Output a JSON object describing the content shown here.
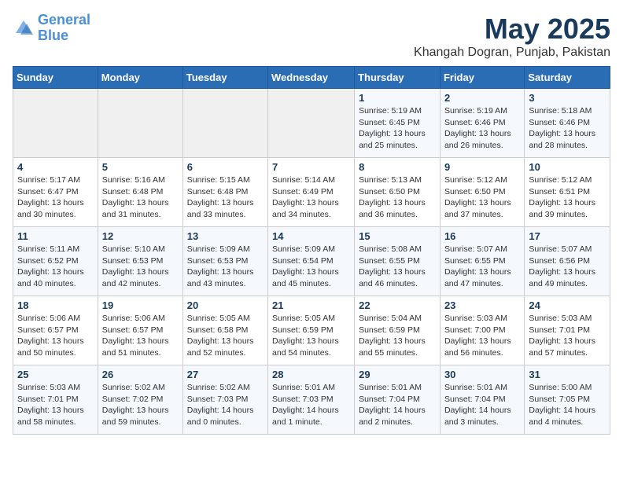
{
  "logo": {
    "line1": "General",
    "line2": "Blue"
  },
  "title": "May 2025",
  "subtitle": "Khangah Dogran, Punjab, Pakistan",
  "weekdays": [
    "Sunday",
    "Monday",
    "Tuesday",
    "Wednesday",
    "Thursday",
    "Friday",
    "Saturday"
  ],
  "weeks": [
    [
      {
        "day": "",
        "info": ""
      },
      {
        "day": "",
        "info": ""
      },
      {
        "day": "",
        "info": ""
      },
      {
        "day": "",
        "info": ""
      },
      {
        "day": "1",
        "info": "Sunrise: 5:19 AM\nSunset: 6:45 PM\nDaylight: 13 hours\nand 25 minutes."
      },
      {
        "day": "2",
        "info": "Sunrise: 5:19 AM\nSunset: 6:46 PM\nDaylight: 13 hours\nand 26 minutes."
      },
      {
        "day": "3",
        "info": "Sunrise: 5:18 AM\nSunset: 6:46 PM\nDaylight: 13 hours\nand 28 minutes."
      }
    ],
    [
      {
        "day": "4",
        "info": "Sunrise: 5:17 AM\nSunset: 6:47 PM\nDaylight: 13 hours\nand 30 minutes."
      },
      {
        "day": "5",
        "info": "Sunrise: 5:16 AM\nSunset: 6:48 PM\nDaylight: 13 hours\nand 31 minutes."
      },
      {
        "day": "6",
        "info": "Sunrise: 5:15 AM\nSunset: 6:48 PM\nDaylight: 13 hours\nand 33 minutes."
      },
      {
        "day": "7",
        "info": "Sunrise: 5:14 AM\nSunset: 6:49 PM\nDaylight: 13 hours\nand 34 minutes."
      },
      {
        "day": "8",
        "info": "Sunrise: 5:13 AM\nSunset: 6:50 PM\nDaylight: 13 hours\nand 36 minutes."
      },
      {
        "day": "9",
        "info": "Sunrise: 5:12 AM\nSunset: 6:50 PM\nDaylight: 13 hours\nand 37 minutes."
      },
      {
        "day": "10",
        "info": "Sunrise: 5:12 AM\nSunset: 6:51 PM\nDaylight: 13 hours\nand 39 minutes."
      }
    ],
    [
      {
        "day": "11",
        "info": "Sunrise: 5:11 AM\nSunset: 6:52 PM\nDaylight: 13 hours\nand 40 minutes."
      },
      {
        "day": "12",
        "info": "Sunrise: 5:10 AM\nSunset: 6:53 PM\nDaylight: 13 hours\nand 42 minutes."
      },
      {
        "day": "13",
        "info": "Sunrise: 5:09 AM\nSunset: 6:53 PM\nDaylight: 13 hours\nand 43 minutes."
      },
      {
        "day": "14",
        "info": "Sunrise: 5:09 AM\nSunset: 6:54 PM\nDaylight: 13 hours\nand 45 minutes."
      },
      {
        "day": "15",
        "info": "Sunrise: 5:08 AM\nSunset: 6:55 PM\nDaylight: 13 hours\nand 46 minutes."
      },
      {
        "day": "16",
        "info": "Sunrise: 5:07 AM\nSunset: 6:55 PM\nDaylight: 13 hours\nand 47 minutes."
      },
      {
        "day": "17",
        "info": "Sunrise: 5:07 AM\nSunset: 6:56 PM\nDaylight: 13 hours\nand 49 minutes."
      }
    ],
    [
      {
        "day": "18",
        "info": "Sunrise: 5:06 AM\nSunset: 6:57 PM\nDaylight: 13 hours\nand 50 minutes."
      },
      {
        "day": "19",
        "info": "Sunrise: 5:06 AM\nSunset: 6:57 PM\nDaylight: 13 hours\nand 51 minutes."
      },
      {
        "day": "20",
        "info": "Sunrise: 5:05 AM\nSunset: 6:58 PM\nDaylight: 13 hours\nand 52 minutes."
      },
      {
        "day": "21",
        "info": "Sunrise: 5:05 AM\nSunset: 6:59 PM\nDaylight: 13 hours\nand 54 minutes."
      },
      {
        "day": "22",
        "info": "Sunrise: 5:04 AM\nSunset: 6:59 PM\nDaylight: 13 hours\nand 55 minutes."
      },
      {
        "day": "23",
        "info": "Sunrise: 5:03 AM\nSunset: 7:00 PM\nDaylight: 13 hours\nand 56 minutes."
      },
      {
        "day": "24",
        "info": "Sunrise: 5:03 AM\nSunset: 7:01 PM\nDaylight: 13 hours\nand 57 minutes."
      }
    ],
    [
      {
        "day": "25",
        "info": "Sunrise: 5:03 AM\nSunset: 7:01 PM\nDaylight: 13 hours\nand 58 minutes."
      },
      {
        "day": "26",
        "info": "Sunrise: 5:02 AM\nSunset: 7:02 PM\nDaylight: 13 hours\nand 59 minutes."
      },
      {
        "day": "27",
        "info": "Sunrise: 5:02 AM\nSunset: 7:03 PM\nDaylight: 14 hours\nand 0 minutes."
      },
      {
        "day": "28",
        "info": "Sunrise: 5:01 AM\nSunset: 7:03 PM\nDaylight: 14 hours\nand 1 minute."
      },
      {
        "day": "29",
        "info": "Sunrise: 5:01 AM\nSunset: 7:04 PM\nDaylight: 14 hours\nand 2 minutes."
      },
      {
        "day": "30",
        "info": "Sunrise: 5:01 AM\nSunset: 7:04 PM\nDaylight: 14 hours\nand 3 minutes."
      },
      {
        "day": "31",
        "info": "Sunrise: 5:00 AM\nSunset: 7:05 PM\nDaylight: 14 hours\nand 4 minutes."
      }
    ]
  ]
}
